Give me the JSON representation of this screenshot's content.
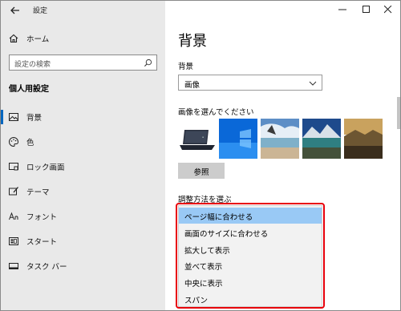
{
  "app": {
    "title": "設定"
  },
  "sidebar": {
    "home_label": "ホーム",
    "search_placeholder": "設定の検索",
    "section_title": "個人用設定",
    "items": [
      {
        "label": "背景",
        "icon": "picture-icon",
        "selected": true
      },
      {
        "label": "色",
        "icon": "palette-icon"
      },
      {
        "label": "ロック画面",
        "icon": "lock-screen-icon"
      },
      {
        "label": "テーマ",
        "icon": "theme-brush-icon"
      },
      {
        "label": "フォント",
        "icon": "font-icon"
      },
      {
        "label": "スタート",
        "icon": "start-grid-icon"
      },
      {
        "label": "タスク バー",
        "icon": "taskbar-icon"
      }
    ]
  },
  "main": {
    "page_title": "背景",
    "background_label": "背景",
    "background_value": "画像",
    "choose_picture_label": "画像を選んでください",
    "browse_label": "参照",
    "fit_label": "調整方法を選ぶ",
    "fit_options": [
      {
        "label": "ページ幅に合わせる",
        "selected": true
      },
      {
        "label": "画面のサイズに合わせる"
      },
      {
        "label": "拡大して表示"
      },
      {
        "label": "並べて表示"
      },
      {
        "label": "中央に表示"
      },
      {
        "label": "スパン"
      }
    ]
  },
  "colors": {
    "accent": "#0067c0",
    "highlight": "#e8000b",
    "selected_option": "#99c9f5"
  }
}
